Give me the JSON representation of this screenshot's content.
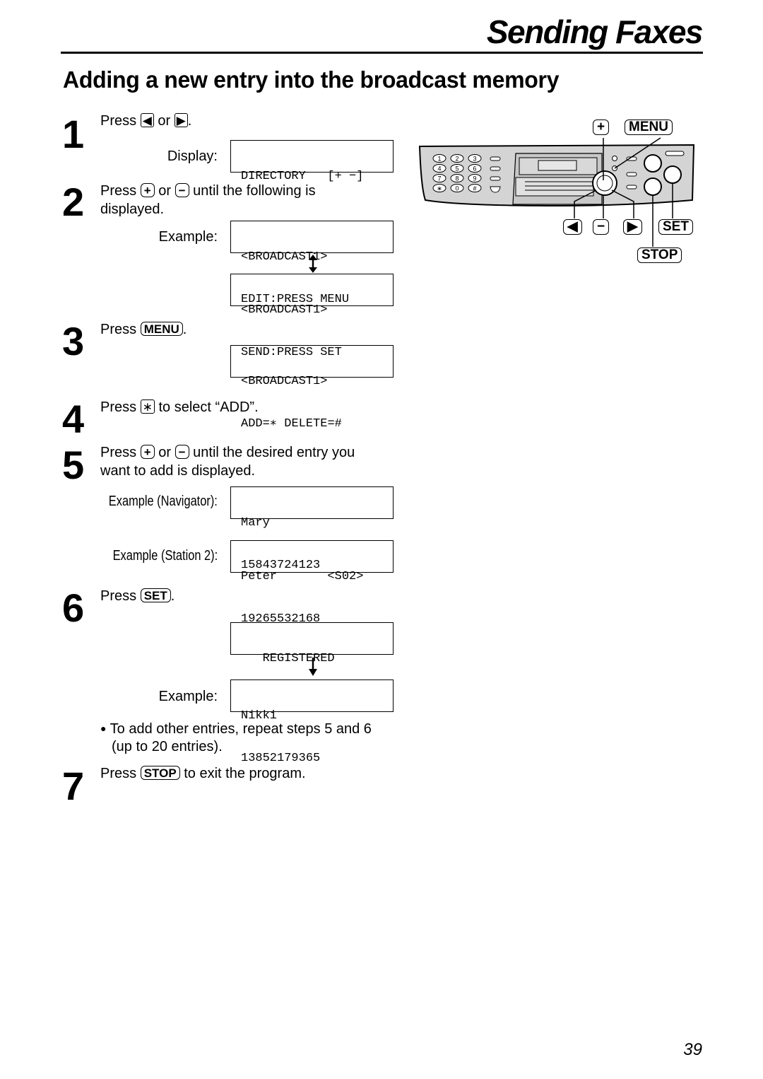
{
  "header": {
    "section_title": "Sending Faxes"
  },
  "heading": "Adding a new entry into the broadcast memory",
  "steps": [
    {
      "num": "1",
      "press": "Press",
      "or": "or",
      "end": ".",
      "keys": [
        "left-arrow",
        "right-arrow"
      ],
      "display_label": "Display:",
      "display": [
        "DIRECTORY   [+ −]",
        ""
      ]
    },
    {
      "num": "2",
      "press": "Press",
      "or": "or",
      "rest": "until the following is",
      "line2": "displayed.",
      "keys": [
        "+",
        "−"
      ],
      "example_label": "Example:",
      "displays": [
        [
          "<BROADCAST1>",
          "EDIT:PRESS MENU"
        ],
        [
          "<BROADCAST1>",
          "SEND:PRESS SET"
        ]
      ]
    },
    {
      "num": "3",
      "press": "Press",
      "key": "MENU",
      "end": ".",
      "display": [
        "<BROADCAST1>",
        "ADD=∗ DELETE=#"
      ]
    },
    {
      "num": "4",
      "press": "Press",
      "key": "∗",
      "rest": "to select “ADD”."
    },
    {
      "num": "5",
      "press": "Press",
      "or": "or",
      "rest": "until the desired entry you",
      "line2": "want to add is displayed.",
      "keys": [
        "+",
        "−"
      ],
      "examples": [
        {
          "label": "Example (Navigator):",
          "display": [
            "Mary",
            "15843724123"
          ]
        },
        {
          "label": "Example (Station 2):",
          "display": [
            "Peter       <S02>",
            "19265532168"
          ]
        }
      ]
    },
    {
      "num": "6",
      "press": "Press",
      "key": "SET",
      "end": ".",
      "display": [
        "   REGISTERED",
        ""
      ],
      "example_label": "Example:",
      "example_display": [
        "Nikki",
        "13852179365"
      ],
      "note_line1": "To add other entries, repeat steps 5 and 6",
      "note_line2": "(up to 20 entries)."
    },
    {
      "num": "7",
      "press": "Press",
      "key": "STOP",
      "rest": "to exit the program."
    }
  ],
  "panel": {
    "labels": {
      "plus": "+",
      "menu": "MENU",
      "left": "◀",
      "minus": "−",
      "right": "▶",
      "set": "SET",
      "stop": "STOP"
    },
    "dial_keys": [
      "1",
      "2",
      "3",
      "4",
      "5",
      "6",
      "7",
      "8",
      "9",
      "∗",
      "0",
      "#"
    ]
  },
  "page_number": "39"
}
